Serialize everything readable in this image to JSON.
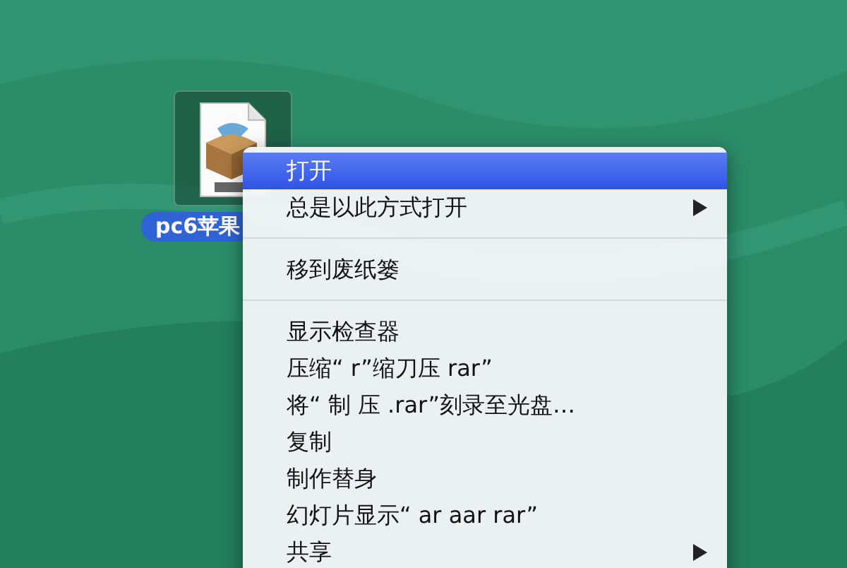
{
  "desktop_icon": {
    "label": "pc6苹果",
    "selected": true
  },
  "context_menu": {
    "items": [
      {
        "kind": "item",
        "label": "打开",
        "selected": true,
        "submenu": false
      },
      {
        "kind": "item",
        "label": "总是以此方式打开",
        "selected": false,
        "submenu": true
      },
      {
        "kind": "separator"
      },
      {
        "kind": "item",
        "label": "移到废纸篓",
        "selected": false,
        "submenu": false
      },
      {
        "kind": "separator"
      },
      {
        "kind": "item",
        "label": "显示检查器",
        "selected": false,
        "submenu": false
      },
      {
        "kind": "item",
        "label": "压缩“ r”缩刀压 rar”",
        "selected": false,
        "submenu": false
      },
      {
        "kind": "item",
        "label": "将“ 制 压 .rar”刻录至光盘…",
        "selected": false,
        "submenu": false
      },
      {
        "kind": "item",
        "label": "复制",
        "selected": false,
        "submenu": false
      },
      {
        "kind": "item",
        "label": "制作替身",
        "selected": false,
        "submenu": false
      },
      {
        "kind": "item",
        "label": "幻灯片显示“ ar aar rar”",
        "selected": false,
        "submenu": false
      },
      {
        "kind": "item",
        "label": "共享",
        "selected": false,
        "submenu": true
      }
    ]
  }
}
